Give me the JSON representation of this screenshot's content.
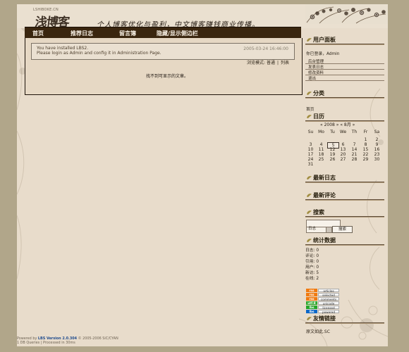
{
  "header": {
    "logo_small": "LSHIBOKE.CN",
    "logo_main": "浅博客",
    "slogan": "个人博客优化与盈利，中文博客赚钱商业传播。"
  },
  "nav": {
    "items": [
      "首页",
      "推荐日志",
      "留言簿",
      "隐藏/显示侧边栏"
    ]
  },
  "notice": {
    "line1": "You have installed LBS2.",
    "line2": "Please login as Admin and config it in Administration Page.",
    "date": "2005-03-24 16:46:00"
  },
  "view_mode": {
    "label": "浏览模式:",
    "normal": "普通",
    "list": "列表"
  },
  "content": {
    "empty": "找不到可显示的文章。"
  },
  "sidebar": {
    "user_panel": {
      "title": "用户面板",
      "login_text": "你已登录，Admin",
      "links": [
        "后台管理",
        "发表日志",
        "修改资料",
        "退出"
      ]
    },
    "categories": {
      "title": "分类",
      "item": "首页"
    },
    "calendar": {
      "title": "日历",
      "caption": "« 2008 »    « 8月 »",
      "weekdays": [
        "Su",
        "Mo",
        "Tu",
        "We",
        "Th",
        "Fr",
        "Sa"
      ],
      "days": [
        "",
        "",
        "",
        "",
        "",
        "1",
        "2",
        "3",
        "4",
        "5",
        "6",
        "7",
        "8",
        "9",
        "10",
        "11",
        "12",
        "13",
        "14",
        "15",
        "16",
        "17",
        "18",
        "19",
        "20",
        "21",
        "22",
        "23",
        "24",
        "25",
        "26",
        "27",
        "28",
        "29",
        "30",
        "31"
      ],
      "today": "5"
    },
    "recent_logs": {
      "title": "最新日志"
    },
    "recent_comments": {
      "title": "最新评论"
    },
    "search": {
      "title": "搜索",
      "input_value": "",
      "select_value": "日志",
      "button": "搜索"
    },
    "stats": {
      "title": "统计数据",
      "lines": [
        "日志: 0",
        "评论: 0",
        "引用: 0",
        "用户: 0",
        "新访: 5",
        "在线: 2"
      ]
    },
    "badges": [
      {
        "left": "rss",
        "right": "articles",
        "color": "#f07a10"
      },
      {
        "left": "rss",
        "right": "selected",
        "color": "#f07a10"
      },
      {
        "left": "rss",
        "right": "comments",
        "color": "#f07a10"
      },
      {
        "left": "utf-8",
        "right": "unicode",
        "color": "#2ea82d"
      },
      {
        "left": "lbs",
        "right": "licensed",
        "color": "#24a629"
      },
      {
        "left": "lbs",
        "right": "powered",
        "color": "#0b67c7"
      }
    ],
    "friends": {
      "title": "友情链接",
      "item": "原文如此.SC"
    }
  },
  "footer": {
    "line1_prefix": "Powered by ",
    "line1_brand": "LBS Version 2.0.304",
    "line1_suffix": " © 2005-2006 SiC/CYAN",
    "line2": "1 DB Queries | Processed in 30ms"
  },
  "colors": {
    "background": "#b1a68a",
    "paper": "#e8dccb",
    "nav": "#3a260f",
    "rule": "#5d4a35"
  }
}
